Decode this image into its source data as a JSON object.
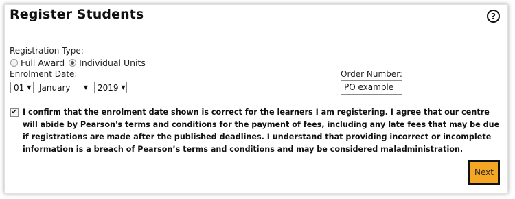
{
  "header": {
    "title": "Register Students",
    "help_icon": "?"
  },
  "form": {
    "registration_type_label": "Registration Type:",
    "registration_options": [
      {
        "label": "Full Award",
        "selected": false
      },
      {
        "label": "Individual Units",
        "selected": true
      }
    ],
    "enrolment_date_label": "Enrolment Date:",
    "day": "01",
    "month": "January",
    "year": "2019",
    "order_number_label": "Order Number:",
    "order_number_value": "PO example",
    "confirm_checked": true,
    "confirm_text": "I confirm that the enrolment date shown is correct for the learners I am registering. I agree that our centre will abide by Pearson's terms and conditions for the payment of fees, including any late fees that may be due if registrations are made after the published deadlines. I understand that providing incorrect or incomplete information is a breach of Pearson’s terms and conditions and may be considered maladministration."
  },
  "actions": {
    "next_label": "Next"
  },
  "colors": {
    "next_button": "#f5a623"
  }
}
